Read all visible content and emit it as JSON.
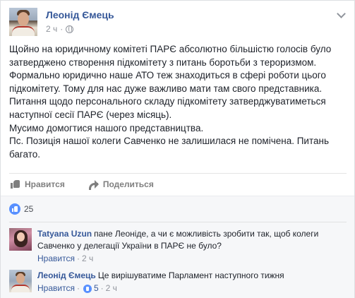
{
  "post": {
    "author": "Леонід Ємець",
    "time": "2 ч",
    "dot": "·",
    "paragraphs": [
      "Щойно на юридичному комітеті ПАРЄ абсолютно більшістю голосів було затверджено створення підкомітету з питань боротьби з тероризмом. Формально юридично наше АТО теж знаходиться в сфері роботи цього підкомітету. Тому для нас дуже важливо мати там свого представника. Питання щодо персонального складу підкомітету затверджуватиметься наступної сесії ПАРЄ (через місяць).",
      "Мусимо домогтися нашого представництва.",
      "Пс. Позиція нашої колеги Савченко не залишилася не помічена. Питань багато."
    ]
  },
  "actions": {
    "like_label": "Нравится",
    "share_label": "Поделиться"
  },
  "reactions": {
    "count": "25"
  },
  "comments": [
    {
      "author": "Tatyana Uzun",
      "text": "пане Леоніде, а чи є можливість зробити так, щоб колеги Савченко у делегації України в ПАРЄ не було?",
      "like_label": "Нравится",
      "dot": "·",
      "time": "2 ч"
    },
    {
      "author": "Леонід Ємець",
      "text": "Це вирішуватиме Парламент наступного тижня",
      "like_label": "Нравится",
      "dot": "·",
      "likes": "5",
      "time": "2 ч"
    }
  ],
  "colors": {
    "link": "#365899",
    "like_blue": "#5890ff",
    "muted": "#90949c"
  }
}
